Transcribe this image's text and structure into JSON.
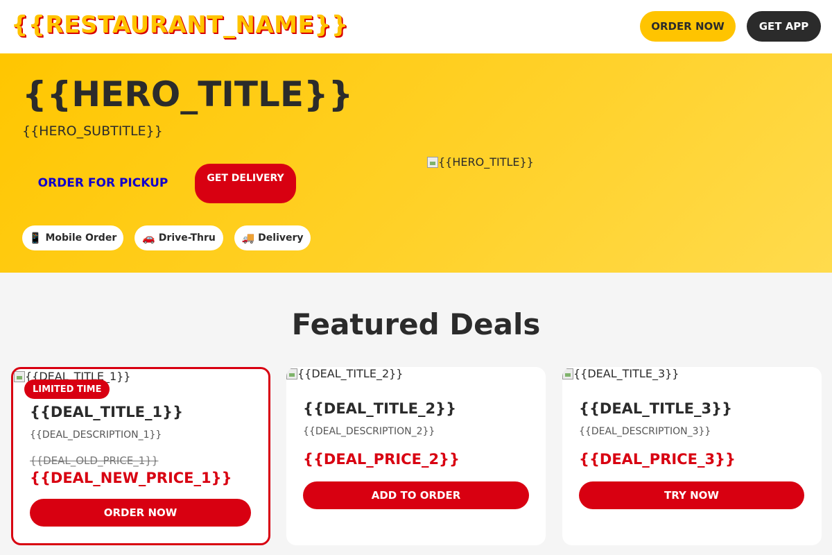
{
  "header": {
    "brand": "{{RESTAURANT_NAME}}",
    "order_now": "ORDER NOW",
    "get_app": "GET APP"
  },
  "hero": {
    "title": "{{HERO_TITLE}}",
    "subtitle": "{{HERO_SUBTITLE}}",
    "pickup_button": "ORDER FOR PICKUP",
    "delivery_button": "GET DELIVERY",
    "image_alt": "{{HERO_TITLE}}",
    "chips": [
      {
        "icon": "📱",
        "label": "Mobile Order"
      },
      {
        "icon": "🚗",
        "label": "Drive-Thru"
      },
      {
        "icon": "🚚",
        "label": "Delivery"
      }
    ]
  },
  "deals": {
    "section_title": "Featured Deals",
    "items": [
      {
        "image_alt": "{{DEAL_TITLE_1}}",
        "badge": "LIMITED TIME",
        "title": "{{DEAL_TITLE_1}}",
        "description": "{{DEAL_DESCRIPTION_1}}",
        "old_price": "{{DEAL_OLD_PRICE_1}}",
        "price": "{{DEAL_NEW_PRICE_1}}",
        "button": "ORDER NOW"
      },
      {
        "image_alt": "{{DEAL_TITLE_2}}",
        "title": "{{DEAL_TITLE_2}}",
        "description": "{{DEAL_DESCRIPTION_2}}",
        "price": "{{DEAL_PRICE_2}}",
        "button": "ADD TO ORDER"
      },
      {
        "image_alt": "{{DEAL_TITLE_3}}",
        "title": "{{DEAL_TITLE_3}}",
        "description": "{{DEAL_DESCRIPTION_3}}",
        "price": "{{DEAL_PRICE_3}}",
        "button": "TRY NOW"
      }
    ]
  },
  "colors": {
    "brand_yellow": "#ffc400",
    "brand_red": "#d80011",
    "dark": "#2b2b2b",
    "link_blue": "#1100cc"
  }
}
